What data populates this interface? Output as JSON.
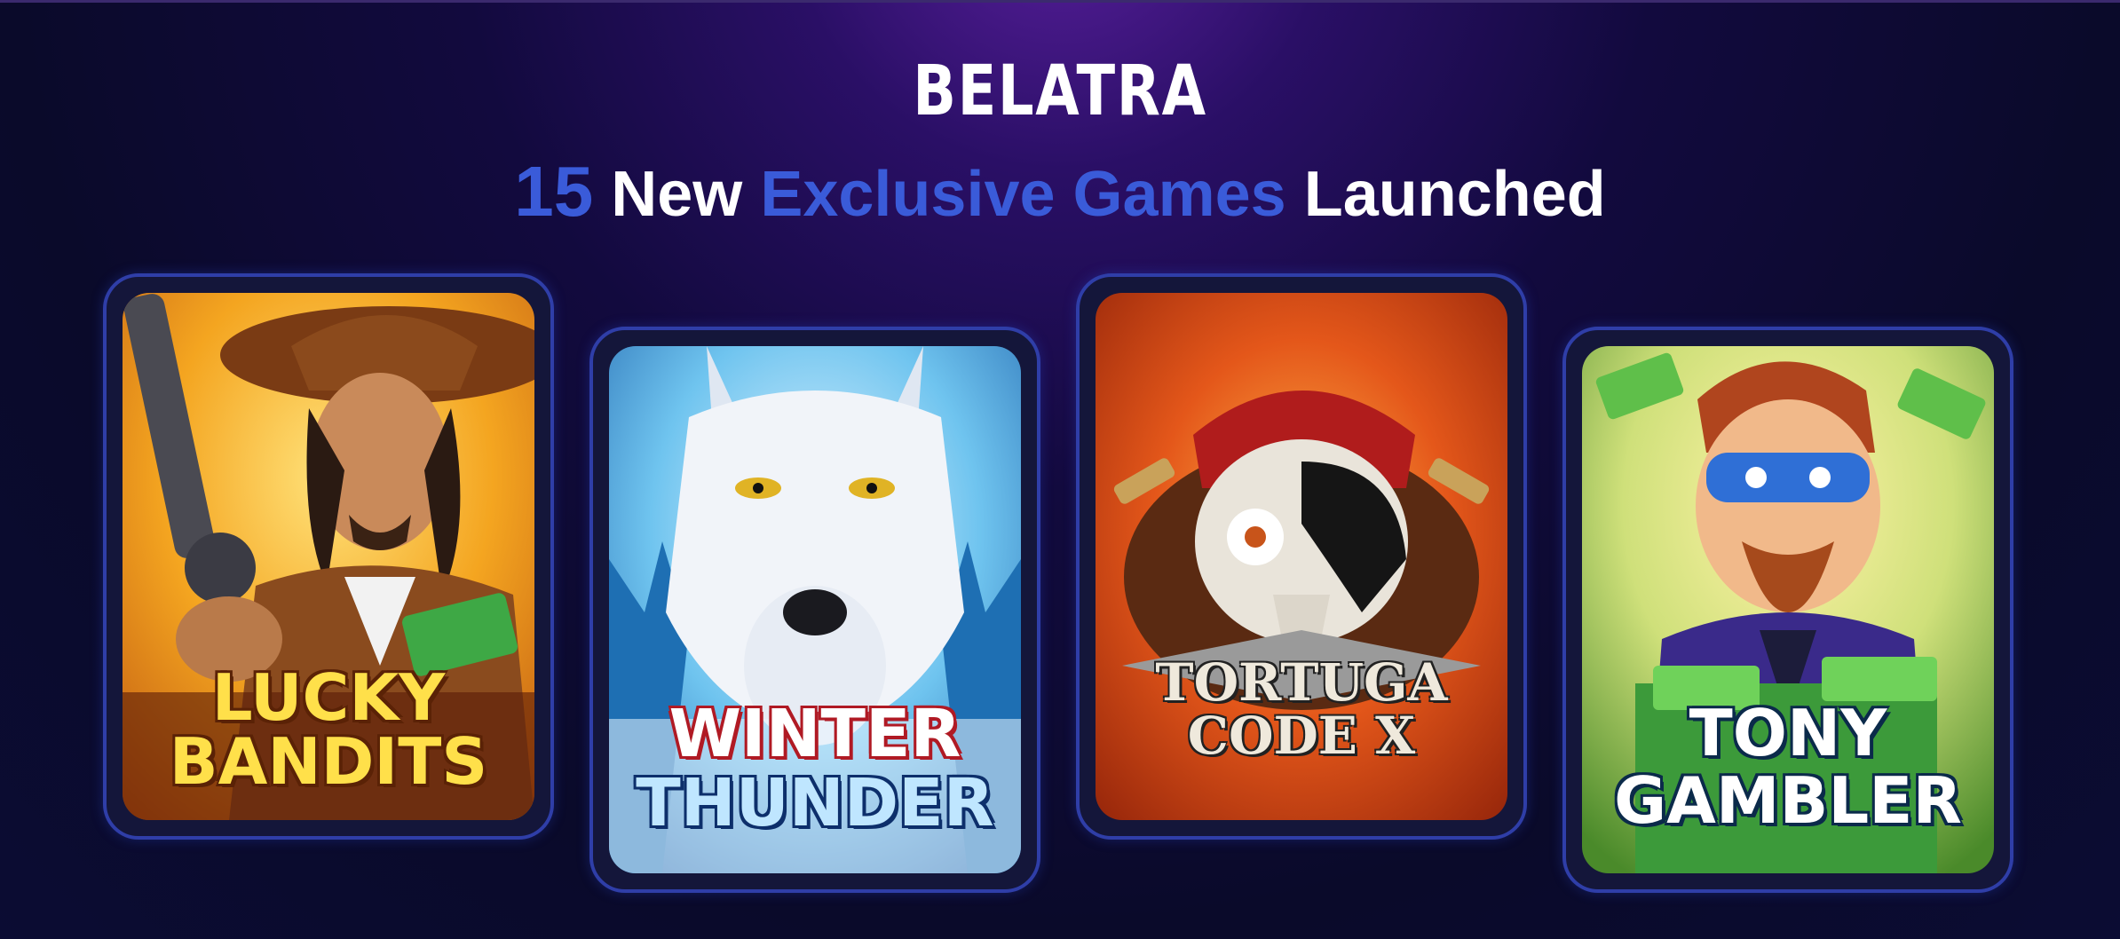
{
  "header": {
    "brand": "BELATRA",
    "headline": {
      "count": "15",
      "part1": "New",
      "accent": "Exclusive Games",
      "part2": "Launched"
    }
  },
  "colors": {
    "accent_blue": "#3a5bd9",
    "card_border": "#2f3ea8",
    "background_dark": "#0a0a2a"
  },
  "games": [
    {
      "line1": "LUCKY",
      "line2": "BANDITS",
      "art": "cowboy-with-revolver"
    },
    {
      "line1": "WINTER",
      "line2": "THUNDER",
      "art": "white-wolf"
    },
    {
      "line1": "TORTUGA",
      "line2": "CODE X",
      "art": "pirate-skull"
    },
    {
      "line1": "TONY",
      "line2": "GAMBLER",
      "art": "masked-man-with-cash"
    }
  ]
}
